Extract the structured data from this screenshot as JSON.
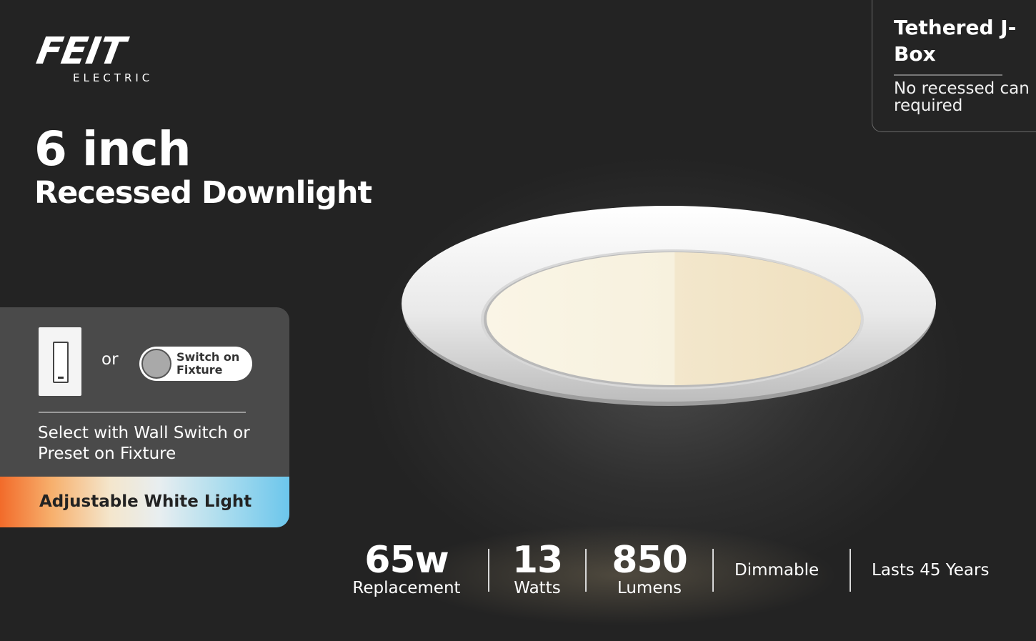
{
  "brand": {
    "name": "FEIT",
    "sub": "ELECTRIC"
  },
  "title": {
    "main": "6 inch",
    "sub": "Recessed Downlight"
  },
  "jbox": {
    "title": "Tethered J-Box",
    "desc": "No recessed can required"
  },
  "panel": {
    "or": "or",
    "switch_label": "Switch on Fixture",
    "description": "Select with Wall Switch or Preset on Fixture",
    "feature": "Adjustable White Light"
  },
  "stats": [
    {
      "big": "65w",
      "small": "Replacement"
    },
    {
      "big": "13",
      "small": "Watts"
    },
    {
      "big": "850",
      "small": "Lumens"
    }
  ],
  "extra_stats": [
    "Dimmable",
    "Lasts 45 Years"
  ],
  "colors": {
    "background": "#222222",
    "panel": "#4a4a4a",
    "bar_warm": "#f26b2a",
    "bar_cool": "#6cc6ec"
  }
}
